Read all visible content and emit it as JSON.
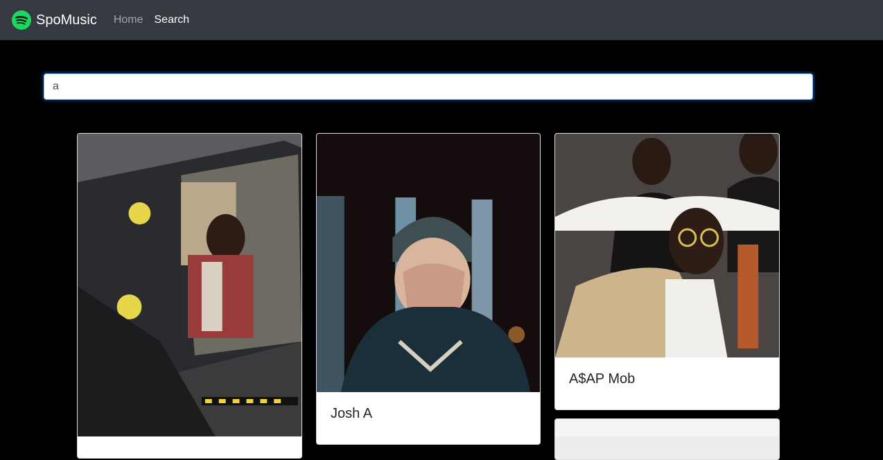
{
  "navbar": {
    "brand": "SpoMusic",
    "brand_color": "#1db954",
    "links": [
      {
        "label": "Home",
        "active": false
      },
      {
        "label": "Search",
        "active": true
      }
    ]
  },
  "search": {
    "value": "a",
    "placeholder": ""
  },
  "results": [
    {
      "name": "",
      "image": "artist-photo-car"
    },
    {
      "name": "Josh A",
      "image": "artist-photo-face-palm"
    },
    {
      "name": "A$AP Mob",
      "image": "group-photo-sunglasses"
    },
    {
      "name": "",
      "image": "artist-photo-light"
    }
  ]
}
